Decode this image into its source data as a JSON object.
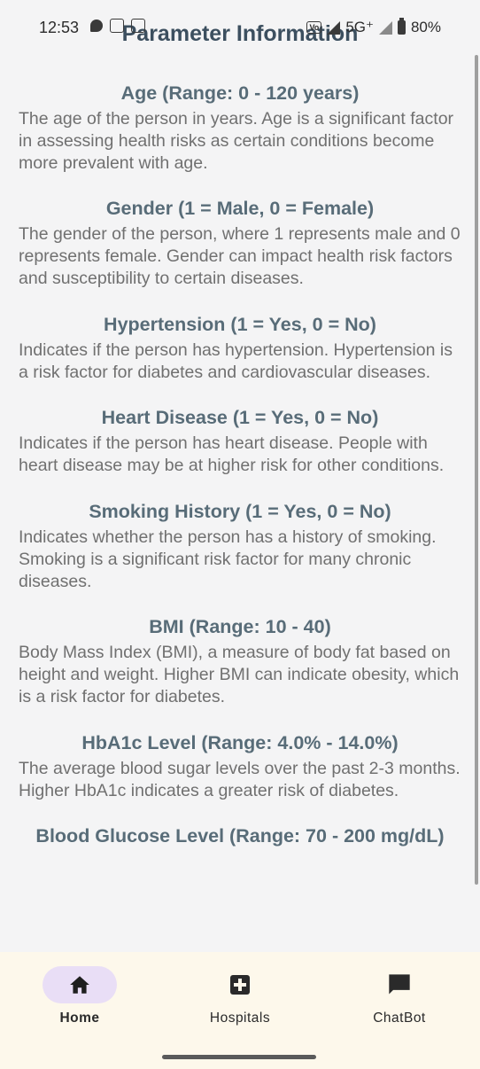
{
  "status_bar": {
    "time": "12:53",
    "network": "5G⁺",
    "volte": "Vo",
    "battery": "80%"
  },
  "page": {
    "title": "Parameter Information"
  },
  "sections": [
    {
      "title": "Age (Range: 0 - 120 years)",
      "body": "The age of the person in years. Age is a significant factor in assessing health risks as certain conditions become more prevalent with age."
    },
    {
      "title": "Gender (1 = Male, 0 = Female)",
      "body": "The gender of the person, where 1 represents male and 0 represents female. Gender can impact health risk factors and susceptibility to certain diseases."
    },
    {
      "title": "Hypertension (1 = Yes, 0 = No)",
      "body": "Indicates if the person has hypertension. Hypertension is a risk factor for diabetes and cardiovascular diseases."
    },
    {
      "title": "Heart Disease (1 = Yes, 0 = No)",
      "body": "Indicates if the person has heart disease. People with heart disease may be at higher risk for other conditions."
    },
    {
      "title": "Smoking History (1 = Yes, 0 = No)",
      "body": "Indicates whether the person has a history of smoking. Smoking is a significant risk factor for many chronic diseases."
    },
    {
      "title": "BMI (Range: 10 - 40)",
      "body": "Body Mass Index (BMI), a measure of body fat based on height and weight. Higher BMI can indicate obesity, which is a risk factor for diabetes."
    },
    {
      "title": "HbA1c Level (Range: 4.0% - 14.0%)",
      "body": "The average blood sugar levels over the past 2-3 months. Higher HbA1c indicates a greater risk of diabetes."
    },
    {
      "title": "Blood Glucose Level (Range: 70 - 200 mg/dL)",
      "body": ""
    }
  ],
  "bottom_nav": {
    "items": [
      {
        "label": "Home",
        "icon": "home-icon",
        "active": true
      },
      {
        "label": "Hospitals",
        "icon": "hospital-icon",
        "active": false
      },
      {
        "label": "ChatBot",
        "icon": "chat-icon",
        "active": false
      }
    ]
  },
  "colors": {
    "title": "#3c4f5f",
    "section_title": "#586c78",
    "body_text": "#707070",
    "nav_background": "#fdf8eb",
    "active_pill": "#e9def6"
  }
}
